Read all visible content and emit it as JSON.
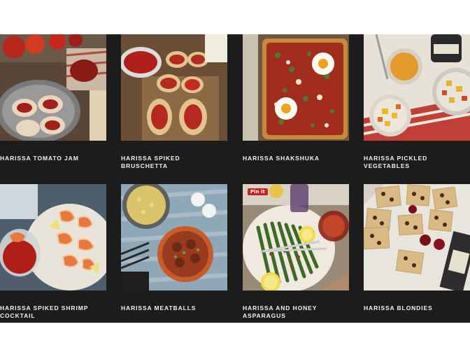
{
  "recipes": [
    {
      "title": "HARISSA TOMATO JAM",
      "photo": "tomato-jam-photo"
    },
    {
      "title": "HARISSA SPIKED BRUSCHETTA",
      "photo": "bruschetta-photo"
    },
    {
      "title": "HARISSA SHAKSHUKA",
      "photo": "shakshuka-photo"
    },
    {
      "title": "HARISSA PICKLED VEGETABLES",
      "photo": "pickled-vegetables-photo"
    },
    {
      "title": "HARISSA SPIKED SHRIMP COCKTAIL",
      "photo": "shrimp-cocktail-photo"
    },
    {
      "title": "HARISSA MEATBALLS",
      "photo": "meatballs-photo"
    },
    {
      "title": "HARISSA AND HONEY ASPARAGUS",
      "photo": "asparagus-photo"
    },
    {
      "title": "HARISSA BLONDIES",
      "photo": "blondies-photo"
    }
  ],
  "pin_badge": "Pin it",
  "colors": {
    "panel": "#1c1c1c",
    "caption": "#f2f2f2",
    "pin": "#cb2027"
  }
}
